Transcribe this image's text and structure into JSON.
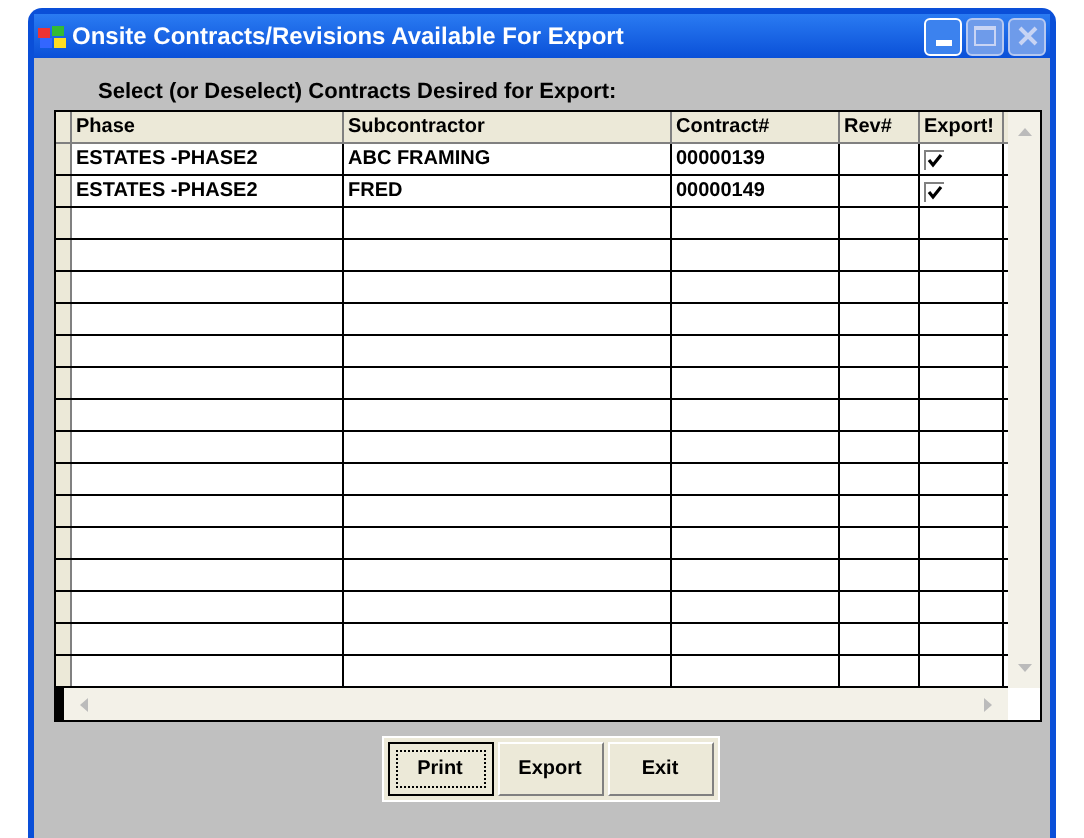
{
  "window": {
    "title": "Onsite Contracts/Revisions Available For Export"
  },
  "instruction": "Select (or Deselect) Contracts Desired for Export:",
  "table": {
    "columns": [
      "Phase",
      "Subcontractor",
      "Contract#",
      "Rev#",
      "Export!"
    ],
    "rows": [
      {
        "phase": "ESTATES -PHASE2",
        "subcontractor": "ABC  FRAMING",
        "contract": "00000139",
        "export": true
      },
      {
        "phase": "ESTATES -PHASE2",
        "subcontractor": "FRED",
        "contract": "00000149",
        "export": true
      }
    ]
  },
  "buttons": [
    {
      "label": "Print",
      "focused": true
    },
    {
      "label": "Export",
      "focused": false
    },
    {
      "label": "Exit",
      "focused": false
    }
  ]
}
